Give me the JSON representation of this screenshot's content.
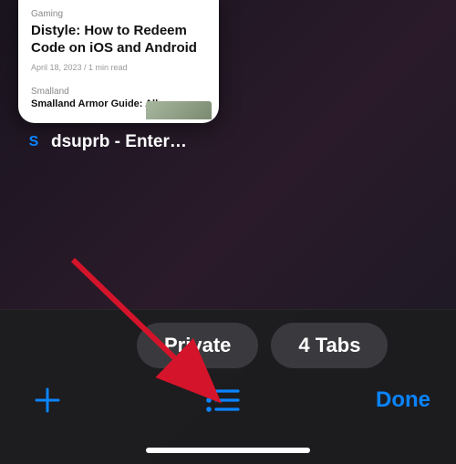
{
  "tab_card": {
    "category": "Gaming",
    "title": "Distyle: How to Redeem Code on iOS and Android",
    "meta": "April 18, 2023 / 1 min read",
    "subcategory": "Smalland",
    "subtitle": "Smalland Armor Guide: All"
  },
  "tab": {
    "favicon_letter": "S",
    "title": "dsuprb - Enter…"
  },
  "pills": {
    "private": "Private",
    "tabs_count": "4 Tabs"
  },
  "toolbar": {
    "done": "Done"
  },
  "annotation": {
    "arrow_color": "#d4142a"
  }
}
